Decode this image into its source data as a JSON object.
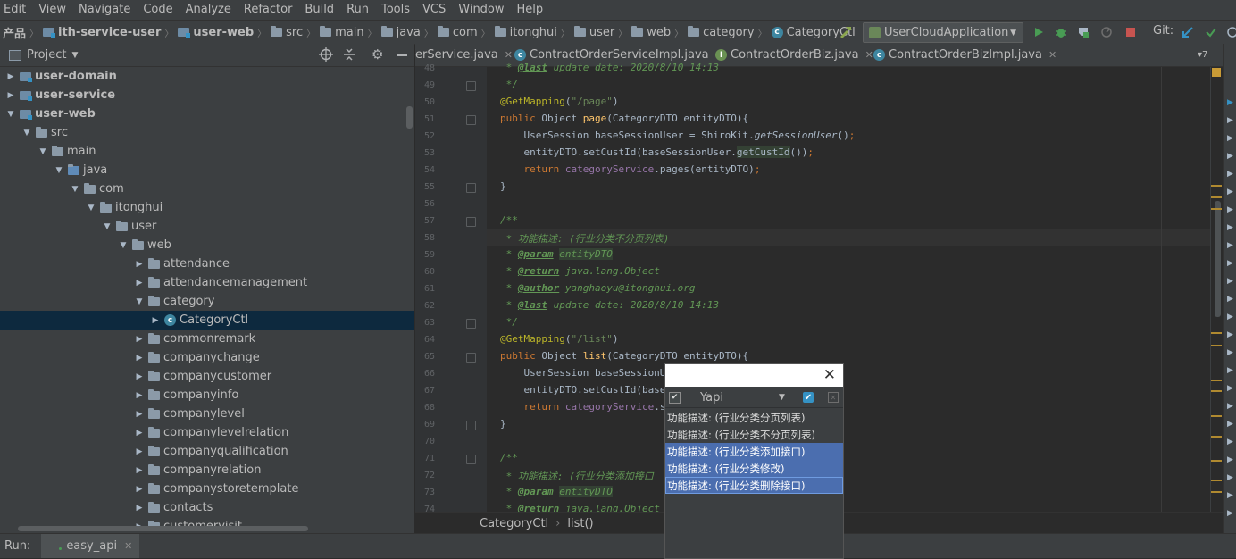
{
  "menu": [
    "Edit",
    "View",
    "Navigate",
    "Code",
    "Analyze",
    "Refactor",
    "Build",
    "Run",
    "Tools",
    "VCS",
    "Window",
    "Help"
  ],
  "navbar": {
    "crumbs": [
      {
        "label": "产品",
        "kind": "none",
        "bold": true
      },
      {
        "label": "ith-service-user",
        "kind": "module",
        "bold": true
      },
      {
        "label": "user-web",
        "kind": "module",
        "bold": true
      },
      {
        "label": "src",
        "kind": "folder",
        "bold": false
      },
      {
        "label": "main",
        "kind": "folder",
        "bold": false
      },
      {
        "label": "java",
        "kind": "folder",
        "bold": false
      },
      {
        "label": "com",
        "kind": "folder",
        "bold": false
      },
      {
        "label": "itonghui",
        "kind": "folder",
        "bold": false
      },
      {
        "label": "user",
        "kind": "folder",
        "bold": false
      },
      {
        "label": "web",
        "kind": "folder",
        "bold": false
      },
      {
        "label": "category",
        "kind": "folder",
        "bold": false
      },
      {
        "label": "CategoryCtl",
        "kind": "class",
        "bold": false
      }
    ],
    "run_config": "UserCloudApplication",
    "git_label": "Git:"
  },
  "project_panel": {
    "title": "Project",
    "tree": [
      {
        "label": "user-domain",
        "depth": 0,
        "state": "collapsed",
        "kind": "module",
        "bold": true
      },
      {
        "label": "user-service",
        "depth": 0,
        "state": "collapsed",
        "kind": "module",
        "bold": true
      },
      {
        "label": "user-web",
        "depth": 0,
        "state": "expanded",
        "kind": "module",
        "bold": true
      },
      {
        "label": "src",
        "depth": 1,
        "state": "expanded",
        "kind": "folder",
        "bold": false
      },
      {
        "label": "main",
        "depth": 2,
        "state": "expanded",
        "kind": "folder",
        "bold": false
      },
      {
        "label": "java",
        "depth": 3,
        "state": "expanded",
        "kind": "src",
        "bold": false
      },
      {
        "label": "com",
        "depth": 4,
        "state": "expanded",
        "kind": "pkg",
        "bold": false
      },
      {
        "label": "itonghui",
        "depth": 5,
        "state": "expanded",
        "kind": "pkg",
        "bold": false
      },
      {
        "label": "user",
        "depth": 6,
        "state": "expanded",
        "kind": "pkg",
        "bold": false
      },
      {
        "label": "web",
        "depth": 7,
        "state": "expanded",
        "kind": "pkg",
        "bold": false
      },
      {
        "label": "attendance",
        "depth": 8,
        "state": "collapsed",
        "kind": "pkg",
        "bold": false
      },
      {
        "label": "attendancemanagement",
        "depth": 8,
        "state": "collapsed",
        "kind": "pkg",
        "bold": false
      },
      {
        "label": "category",
        "depth": 8,
        "state": "expanded",
        "kind": "pkg",
        "bold": false
      },
      {
        "label": "CategoryCtl",
        "depth": 9,
        "state": "collapsed",
        "kind": "class",
        "bold": false,
        "selected": true
      },
      {
        "label": "commonremark",
        "depth": 8,
        "state": "collapsed",
        "kind": "pkg",
        "bold": false
      },
      {
        "label": "companychange",
        "depth": 8,
        "state": "collapsed",
        "kind": "pkg",
        "bold": false
      },
      {
        "label": "companycustomer",
        "depth": 8,
        "state": "collapsed",
        "kind": "pkg",
        "bold": false
      },
      {
        "label": "companyinfo",
        "depth": 8,
        "state": "collapsed",
        "kind": "pkg",
        "bold": false
      },
      {
        "label": "companylevel",
        "depth": 8,
        "state": "collapsed",
        "kind": "pkg",
        "bold": false
      },
      {
        "label": "companylevelrelation",
        "depth": 8,
        "state": "collapsed",
        "kind": "pkg",
        "bold": false
      },
      {
        "label": "companyqualification",
        "depth": 8,
        "state": "collapsed",
        "kind": "pkg",
        "bold": false
      },
      {
        "label": "companyrelation",
        "depth": 8,
        "state": "collapsed",
        "kind": "pkg",
        "bold": false
      },
      {
        "label": "companystoretemplate",
        "depth": 8,
        "state": "collapsed",
        "kind": "pkg",
        "bold": false
      },
      {
        "label": "contacts",
        "depth": 8,
        "state": "collapsed",
        "kind": "pkg",
        "bold": false
      },
      {
        "label": "customervisit",
        "depth": 8,
        "state": "collapsed",
        "kind": "pkg",
        "bold": false
      }
    ]
  },
  "editor_tabs": [
    {
      "label": "erService.java"
    },
    {
      "label": "ContractOrderServiceImpl.java"
    },
    {
      "label": "ContractOrderBiz.java"
    },
    {
      "label": "ContractOrderBizImpl.java"
    }
  ],
  "tab_overflow": "▾7",
  "code_lines": [
    {
      "n": "48",
      "html": "<span class=\"jd\"> * </span><span class=\"tag\">@last</span><span class=\"jd\"> update date: 2020/8/10 14:13</span>"
    },
    {
      "n": "49",
      "html": "<span class=\"jd\"> */</span>"
    },
    {
      "n": "50",
      "html": "<span class=\"an\">@GetMapping</span>(<span class=\"st\">\"/page\"</span>)"
    },
    {
      "n": "51",
      "html": "<span class=\"kw\">public</span> Object <span class=\"mt\">page</span>(CategoryDTO entityDTO){"
    },
    {
      "n": "52",
      "html": "    UserSession baseSessionUser = ShiroKit.<span class=\"itm\">getSessionUser</span>()<span class=\"kw\">;</span>"
    },
    {
      "n": "53",
      "html": "    entityDTO.setCustId(baseSessionUser.<span class=\"hl\">getCustId</span>())<span class=\"kw\">;</span>"
    },
    {
      "n": "54",
      "html": "    <span class=\"kw\">return</span> <span class=\"fd\">categoryService</span>.pages(entityDTO)<span class=\"kw\">;</span>"
    },
    {
      "n": "55",
      "html": "}"
    },
    {
      "n": "56",
      "html": ""
    },
    {
      "n": "57",
      "html": "<span class=\"jd\">/**</span>"
    },
    {
      "n": "58",
      "html": "<span class=\"cp\"> * 功能描述: (行业分类不分页列表)</span>"
    },
    {
      "n": "59",
      "html": "<span class=\"jd\"> * </span><span class=\"tag\">@param</span> <span class=\"jd hl\">entityDTO</span>"
    },
    {
      "n": "60",
      "html": "<span class=\"jd\"> * </span><span class=\"tag\">@return</span><span class=\"jd\"> java.lang.Object</span>"
    },
    {
      "n": "61",
      "html": "<span class=\"jd\"> * </span><span class=\"tag\">@author</span><span class=\"jd\"> yanghaoyu@itonghui.org</span>"
    },
    {
      "n": "62",
      "html": "<span class=\"jd\"> * </span><span class=\"tag\">@last</span><span class=\"jd\"> update date: 2020/8/10 14:13</span>"
    },
    {
      "n": "63",
      "html": "<span class=\"jd\"> */</span>"
    },
    {
      "n": "64",
      "html": "<span class=\"an\">@GetMapping</span>(<span class=\"st\">\"/list\"</span>)"
    },
    {
      "n": "65",
      "html": "<span class=\"kw\">public</span> Object <span class=\"mt\">list</span>(CategoryDTO entityDTO){"
    },
    {
      "n": "66",
      "html": "    UserSession baseSessionUs"
    },
    {
      "n": "67",
      "html": "    entityDTO.setCustId(baseS"
    },
    {
      "n": "68",
      "html": "    <span class=\"kw\">return</span> <span class=\"fd\">categoryService</span>.se"
    },
    {
      "n": "69",
      "html": "}"
    },
    {
      "n": "70",
      "html": ""
    },
    {
      "n": "71",
      "html": "<span class=\"jd\">/**</span>"
    },
    {
      "n": "72",
      "html": "<span class=\"cp\"> * 功能描述: (行业分类添加接口</span>"
    },
    {
      "n": "73",
      "html": "<span class=\"jd\"> * </span><span class=\"tag\">@param</span> <span class=\"jd hl\">entityDTO</span>"
    },
    {
      "n": "74",
      "html": "<span class=\"jd\"> * </span><span class=\"tag\">@return</span><span class=\"jd\"> java.lang.Object</span>"
    }
  ],
  "editor_breadcrumb": {
    "class": "CategoryCtl",
    "method": "list()"
  },
  "run_bar": {
    "label": "Run:",
    "tab": "easy_api"
  },
  "popup": {
    "dropdown_value": "Yapi",
    "items": [
      {
        "label": "功能描述: (行业分类分页列表)",
        "selected": false,
        "focus": false
      },
      {
        "label": "功能描述: (行业分类不分页列表)",
        "selected": false,
        "focus": false
      },
      {
        "label": "功能描述: (行业分类添加接口)",
        "selected": true,
        "focus": false
      },
      {
        "label": "功能描述: (行业分类修改)",
        "selected": true,
        "focus": false
      },
      {
        "label": "功能描述: (行业分类删除接口)",
        "selected": true,
        "focus": true
      }
    ]
  },
  "colors": {
    "selection": "#0d293e",
    "popup_selection": "#4b6eaf",
    "run_green": "#499c54",
    "stop_red": "#c75450"
  }
}
